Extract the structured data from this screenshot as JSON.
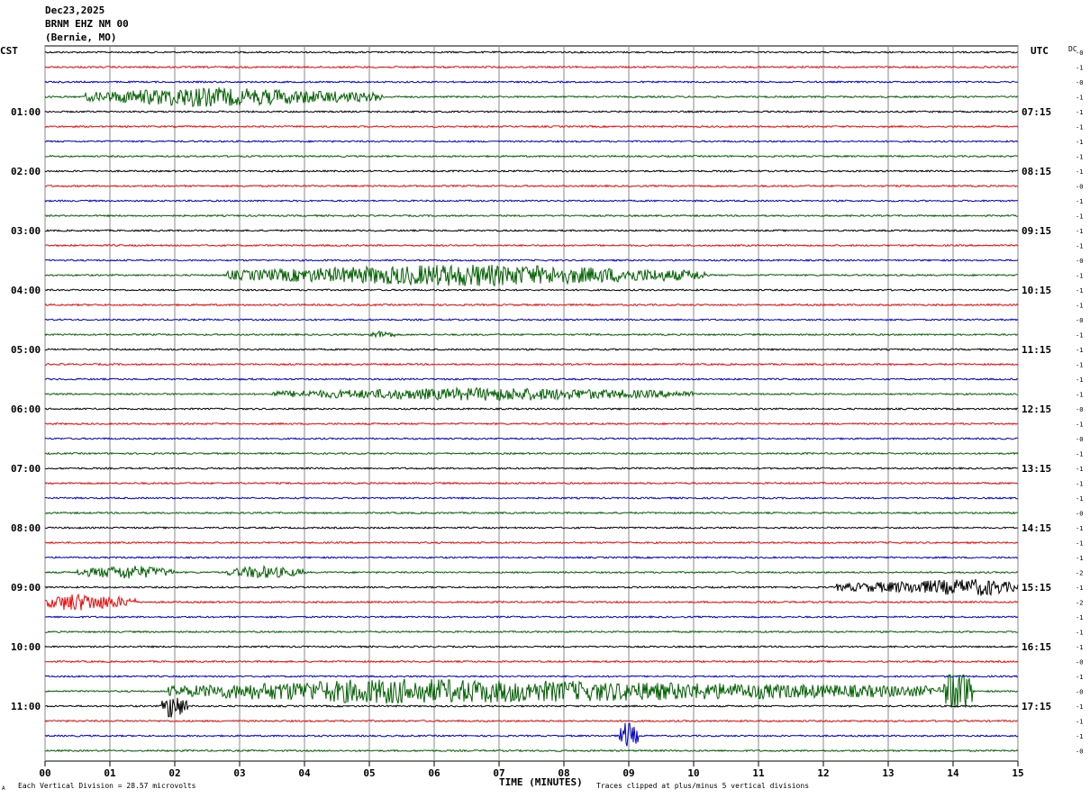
{
  "header": {
    "date": "Dec23,2025",
    "station": "BRNM EHZ NM 00",
    "location": "(Bernie, MO)"
  },
  "left_tz": "CST",
  "right_tz": "UTC",
  "dc_label": "DC",
  "footer": {
    "division_note": "Each Vertical Division =   28.57 microvolts",
    "clip_note": "Traces clipped at plus/minus 5 vertical divisions",
    "corner_mark": "A"
  },
  "colors": {
    "black": "#000000",
    "red": "#ff0000",
    "blue": "#0000cc",
    "green": "#006400",
    "grid": "#888888"
  },
  "chart_data": {
    "type": "line",
    "title": "",
    "xlabel": "TIME (MINUTES)",
    "ylabel": "",
    "xlim": [
      0,
      15
    ],
    "x_ticks": [
      "00",
      "01",
      "02",
      "03",
      "04",
      "05",
      "06",
      "07",
      "08",
      "09",
      "10",
      "11",
      "12",
      "13",
      "14",
      "15"
    ],
    "trace_count": 48,
    "trace_color_cycle": [
      "black",
      "red",
      "blue",
      "green"
    ],
    "left_hour_labels": [
      "01:00",
      "02:00",
      "03:00",
      "04:00",
      "05:00",
      "06:00",
      "07:00",
      "08:00",
      "09:00",
      "10:00",
      "11:00"
    ],
    "right_hour_labels": [
      "07:15",
      "08:15",
      "09:15",
      "10:15",
      "11:15",
      "12:15",
      "13:15",
      "14:15",
      "15:15",
      "16:15",
      "17:15"
    ],
    "dc_offsets": [
      "-0",
      "-1",
      "-0",
      "-1",
      "-1",
      "-1",
      "-1",
      "-1",
      "-1",
      "-0",
      "-1",
      "-1",
      "-1",
      "-1",
      "-0",
      "-1",
      "-1",
      "-1",
      "-0",
      "-1",
      "-1",
      "-1",
      "-1",
      "-1",
      "-0",
      "-1",
      "-0",
      "-1",
      "-1",
      "-1",
      "-1",
      "-0",
      "-1",
      "-1",
      "-1",
      "-2",
      "-1",
      "-2",
      "-1",
      "-1",
      "-1",
      "-0",
      "-1",
      "-0",
      "-1",
      "-1",
      "-1",
      "-0"
    ],
    "events": [
      {
        "trace": 3,
        "start_min": 0.6,
        "end_min": 5.2,
        "peak_min": 2.3,
        "amplitude": 1.4
      },
      {
        "trace": 15,
        "start_min": 2.8,
        "end_min": 10.2,
        "peak_min": 6.5,
        "amplitude": 1.6
      },
      {
        "trace": 19,
        "start_min": 5.0,
        "end_min": 5.4,
        "peak_min": 5.2,
        "amplitude": 0.5
      },
      {
        "trace": 23,
        "start_min": 3.5,
        "end_min": 10.0,
        "peak_min": 7.0,
        "amplitude": 0.9
      },
      {
        "trace": 35,
        "start_min": 0.5,
        "end_min": 2.0,
        "peak_min": 1.3,
        "amplitude": 1.0
      },
      {
        "trace": 35,
        "start_min": 2.8,
        "end_min": 4.0,
        "peak_min": 3.3,
        "amplitude": 0.9
      },
      {
        "trace": 36,
        "start_min": 12.2,
        "end_min": 15.0,
        "peak_min": 14.5,
        "amplitude": 1.2
      },
      {
        "trace": 37,
        "start_min": 0.0,
        "end_min": 1.4,
        "peak_min": 0.4,
        "amplitude": 1.3
      },
      {
        "trace": 43,
        "start_min": 1.9,
        "end_min": 13.8,
        "peak_min": 5.2,
        "amplitude": 1.8
      },
      {
        "trace": 43,
        "start_min": 13.85,
        "end_min": 14.3,
        "peak_min": 13.95,
        "amplitude": 5.0
      },
      {
        "trace": 44,
        "start_min": 1.8,
        "end_min": 2.2,
        "peak_min": 1.95,
        "amplitude": 2.0
      },
      {
        "trace": 46,
        "start_min": 8.85,
        "end_min": 9.15,
        "peak_min": 8.97,
        "amplitude": 2.2
      }
    ]
  }
}
